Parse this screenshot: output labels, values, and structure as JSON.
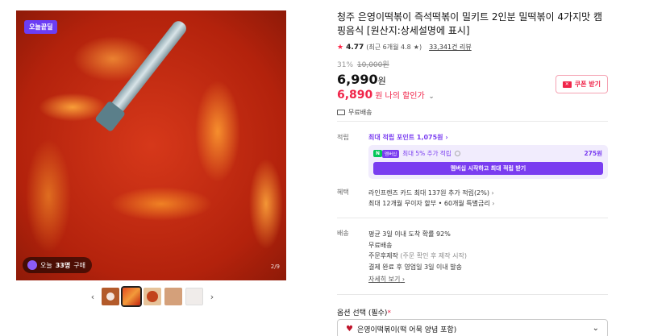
{
  "gallery": {
    "badge": "오늘끝딜",
    "bought_prefix": "오늘",
    "bought_count": "33명",
    "bought_suffix": "구매",
    "page_indicator": "2/9",
    "thumbnail_count": 5,
    "selected_thumbnail": 2
  },
  "product": {
    "title": "청주 은영이떡볶이 즉석떡볶이 밀키트 2인분 밀떡볶이 4가지맛 캠핑음식 [원산지:상세설명에 표시]",
    "rating": "4.77",
    "recent_rating": "(최근 6개월 4.8",
    "review_count": "33,341건 리뷰",
    "discount_pct": "31%",
    "original_price": "10,000원",
    "sale_price": "6,990",
    "sale_unit": "원",
    "my_price": "6,890",
    "my_price_unit": "원",
    "my_price_label": "나의 할인가",
    "coupon_label": "쿠폰 받기",
    "free_shipping": "무료배송"
  },
  "points": {
    "label": "적립",
    "max_points": "최대 적립 포인트 1,075원",
    "npay": "N",
    "membership": "멤버십",
    "extra_text": "최대 5% 추가 적립",
    "extra_amount": "275원",
    "join_button": "멤버십 시작하고 최대 적립 받기"
  },
  "benefits": {
    "label": "혜택",
    "lines": [
      "라인프렌즈 카드 최대 137원 추가 적립(2%)",
      "최대 12개월 무이자 할부 • 60개월 특별금리"
    ]
  },
  "shipping": {
    "label": "배송",
    "line1": "평균 3일 이내 도착 확률 92%",
    "line2": "무료배송",
    "line3_main": "주문후제작",
    "line3_note": "(주문 확인 후 제작 시작)",
    "line4": "결제 완료 후 영업일 3일 이내 발송",
    "detail_link": "자세히 보기"
  },
  "option": {
    "title": "옵션 선택 (필수)",
    "required_mark": "*",
    "selected": "은영이떡볶이(떡 어묵 양념 포함)"
  },
  "colors": {
    "accent_purple": "#7a3df0",
    "price_red": "#f0254a",
    "npay_green": "#03c75a"
  }
}
